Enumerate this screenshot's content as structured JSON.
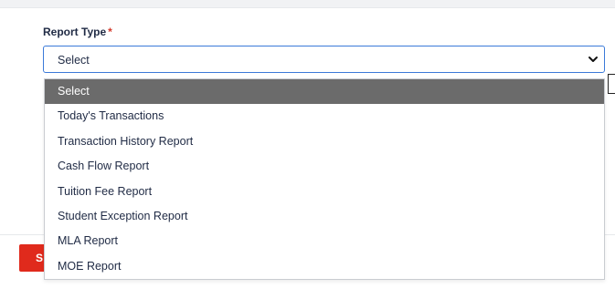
{
  "form": {
    "report_type_label": "Report Type",
    "required_marker": "*",
    "report_type_value": "Select",
    "submit_partial_label": "S"
  },
  "dropdown": {
    "options": [
      "Select",
      "Today's Transactions",
      "Transaction History Report",
      "Cash Flow Report",
      "Tuition Fee Report",
      "Student Exception Report",
      "MLA Report",
      "MOE Report"
    ],
    "selected_index": 0
  },
  "colors": {
    "accent_border": "#3b7ad9",
    "highlight": "#6b6b6b",
    "button_red": "#e02a1c",
    "required_red": "#d33a2c"
  },
  "icons": {
    "select_arrow": "chevron-down-icon"
  }
}
